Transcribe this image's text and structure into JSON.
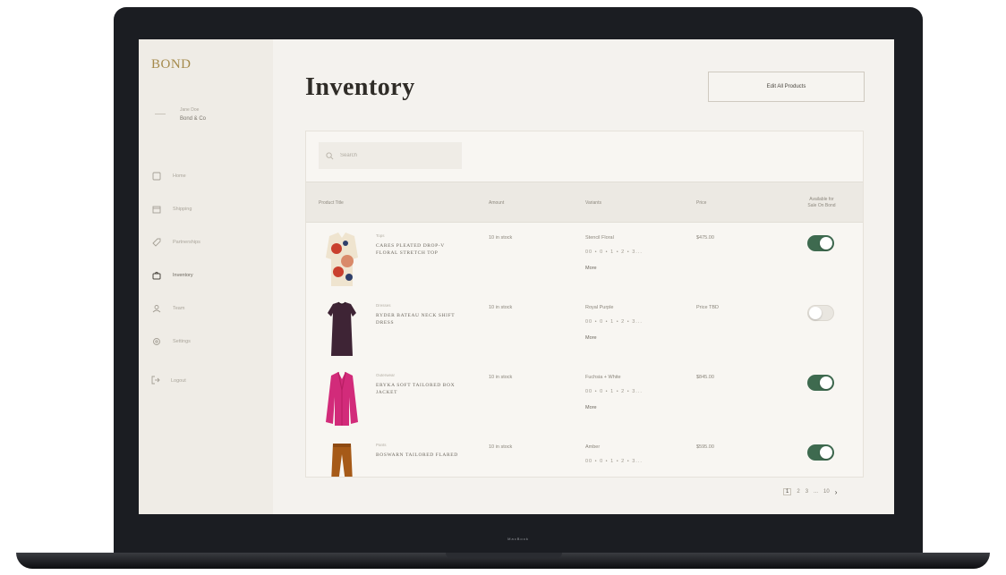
{
  "app": {
    "logo": "BOND",
    "device_brand": "MacBook"
  },
  "user": {
    "name": "Jane Doe",
    "store": "Bond & Co"
  },
  "sidebar": {
    "items": [
      {
        "label": "Home",
        "icon": "square-icon",
        "active": false
      },
      {
        "label": "Shipping",
        "icon": "box-icon",
        "active": false
      },
      {
        "label": "Partnerships",
        "icon": "tag-icon",
        "active": false
      },
      {
        "label": "Inventory",
        "icon": "bag-icon",
        "active": true
      },
      {
        "label": "Team",
        "icon": "user-icon",
        "active": false
      },
      {
        "label": "Settings",
        "icon": "gear-icon",
        "active": false
      }
    ],
    "logout_label": "Logout"
  },
  "main": {
    "title": "Inventory",
    "edit_button_label": "Edit All Products",
    "search_placeholder": "Search"
  },
  "table": {
    "headers": {
      "title": "Product Title",
      "stock": "Amount",
      "variants": "Variants",
      "price": "Price",
      "available_line1": "Available for",
      "available_line2": "Sale On Bond"
    },
    "rows": [
      {
        "type": "Tops",
        "title": "CARES PLEATED DROP-V FLORAL STRETCH TOP",
        "stock": "10 in stock",
        "variant": "Stencil Floral",
        "sizes": "00 • 0 • 1 • 2 • 3...",
        "more": "More",
        "price": "$475.00",
        "available": true,
        "thumb_colors": [
          "#c9402e",
          "#efe4cf",
          "#d98a6a"
        ]
      },
      {
        "type": "Dresses",
        "title": "RYDER BATEAU NECK SHIFT DRESS",
        "stock": "10 in stock",
        "variant": "Royal Purple",
        "sizes": "00 • 0 • 1 • 2 • 3...",
        "more": "More",
        "price": "Price TBD",
        "available": false,
        "thumb_colors": [
          "#3e2435",
          "#4d2d42",
          "#2a1822"
        ]
      },
      {
        "type": "Outerwear",
        "title": "ERYKA SOFT TAILORED BOX JACKET",
        "stock": "10 in stock",
        "variant": "Fuchsia + White",
        "sizes": "00 • 0 • 1 • 2 • 3...",
        "more": "More",
        "price": "$845.00",
        "available": true,
        "thumb_colors": [
          "#d22b7a",
          "#e8449a",
          "#b81e63"
        ]
      },
      {
        "type": "Pants",
        "title": "BOSWARN TAILORED FLARED",
        "stock": "10 in stock",
        "variant": "Amber",
        "sizes": "00 • 0 • 1 • 2 • 3...",
        "more": "",
        "price": "$595.00",
        "available": true,
        "thumb_colors": [
          "#a65a18",
          "#c2721f",
          "#8e4a12"
        ]
      }
    ]
  },
  "pagination": {
    "current": "1",
    "pages": [
      "2",
      "3",
      "...",
      "10"
    ],
    "next": "›"
  },
  "colors": {
    "accent_green": "#3e6a4f",
    "logo_gold": "#a58a4b",
    "background": "#f4f2ee"
  }
}
